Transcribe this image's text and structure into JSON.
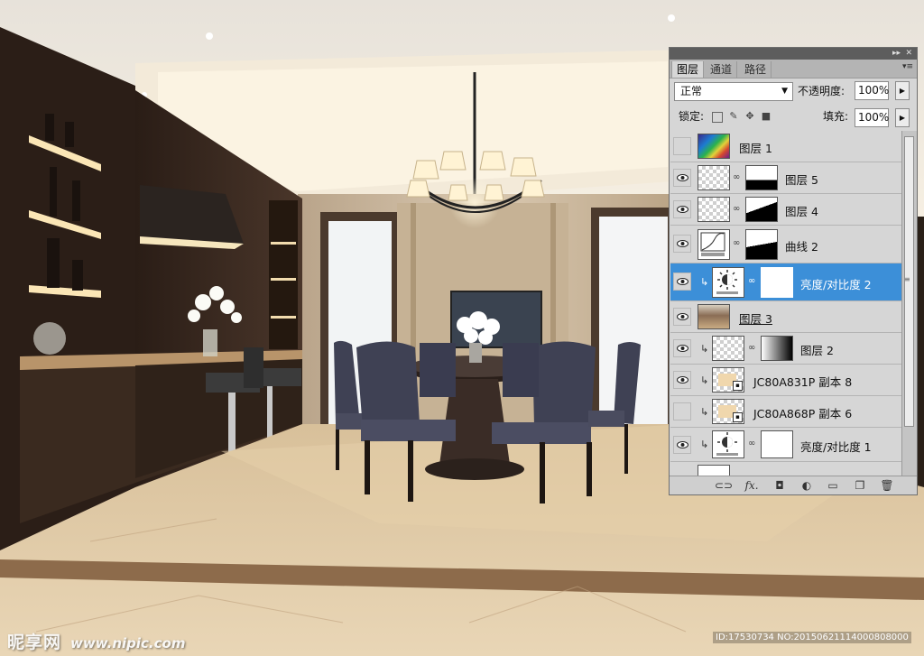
{
  "panel": {
    "collapse_icon": "▸▸",
    "close_icon": "✕",
    "tabs": [
      {
        "label": "图层",
        "active": true
      },
      {
        "label": "通道",
        "active": false
      },
      {
        "label": "路径",
        "active": false
      }
    ],
    "menu_icon": "▾≡",
    "blend_mode": "正常",
    "opacity_label": "不透明度:",
    "opacity_value": "100%",
    "lock_label": "锁定:",
    "fill_label": "填充:",
    "fill_value": "100%",
    "layers": [
      {
        "name": "图层 1",
        "visible": false,
        "thumb": "rainbow",
        "mask": false,
        "clipped": false,
        "selected": false
      },
      {
        "name": "图层 5",
        "visible": true,
        "thumb": "checker-scene",
        "mask": true,
        "clipped": false,
        "selected": false
      },
      {
        "name": "图层 4",
        "visible": true,
        "thumb": "checker-scene",
        "mask": true,
        "clipped": false,
        "selected": false
      },
      {
        "name": "曲线 2",
        "visible": true,
        "thumb": "curves",
        "mask": true,
        "clipped": false,
        "selected": false
      },
      {
        "name": "亮度/对比度 2",
        "visible": true,
        "thumb": "brightness",
        "mask": true,
        "clipped": true,
        "selected": true
      },
      {
        "name": "图层 3",
        "visible": true,
        "thumb": "photo",
        "mask": false,
        "clipped": false,
        "selected": false
      },
      {
        "name": "图层 2",
        "visible": true,
        "thumb": "checker",
        "mask": true,
        "clipped": true,
        "selected": false
      },
      {
        "name": "JC80A831P 副本 8",
        "visible": true,
        "thumb": "smart",
        "mask": false,
        "clipped": true,
        "selected": false
      },
      {
        "name": "JC80A868P 副本 6",
        "visible": false,
        "thumb": "smart",
        "mask": false,
        "clipped": true,
        "selected": false
      },
      {
        "name": "亮度/对比度 1",
        "visible": true,
        "thumb": "brightness",
        "mask": true,
        "clipped": true,
        "selected": false
      }
    ],
    "bottom_buttons": [
      "link-icon",
      "fx-icon",
      "mask-icon",
      "adjustment-icon",
      "group-folder-icon",
      "new-layer-icon",
      "trash-icon"
    ]
  },
  "watermark": {
    "left_text": "昵享网",
    "left_url": "www.nipic.com",
    "right_text": "ID:17530734 NO:20150621114000808000"
  }
}
